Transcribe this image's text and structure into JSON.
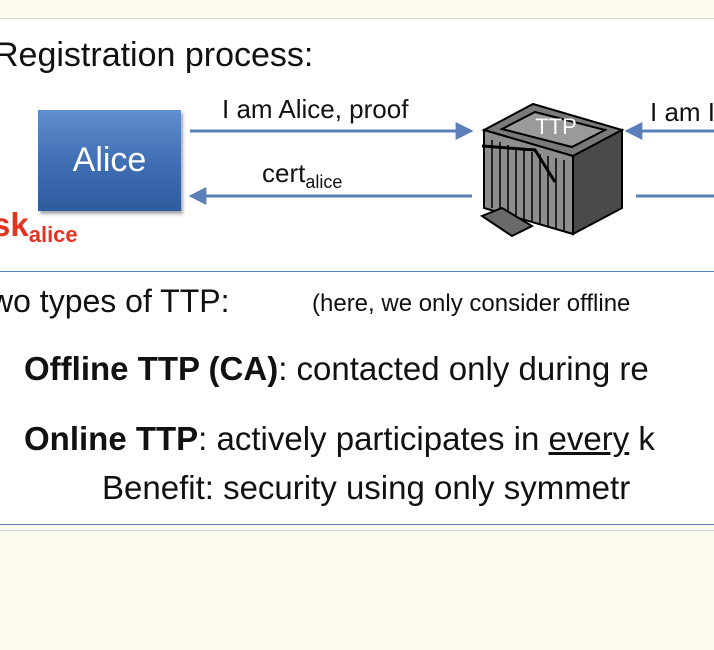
{
  "registration": {
    "heading": "Registration process:",
    "alice_label": "Alice",
    "sk_main": "sk",
    "sk_sub": "alice",
    "arrow_top_label": "I am Alice,  proof",
    "arrow_bottom_main": "cert",
    "arrow_bottom_sub": "alice",
    "ttp_label": "TTP",
    "right_arrow_label": "I am I"
  },
  "types": {
    "heading": "wo types of TTP:",
    "note": "(here, we only consider offline",
    "offline_term": "Offline TTP (CA)",
    "offline_desc": ":  contacted only during re",
    "online_term": "Online TTP",
    "online_desc_pre": ": actively participates in ",
    "online_desc_underlined": "every",
    "online_desc_post": " k",
    "benefit": "Benefit:   security using only symmetr"
  },
  "colors": {
    "arrow": "#5b7fb8",
    "alice_box": "#3e6db2",
    "sk": "#e43320"
  }
}
